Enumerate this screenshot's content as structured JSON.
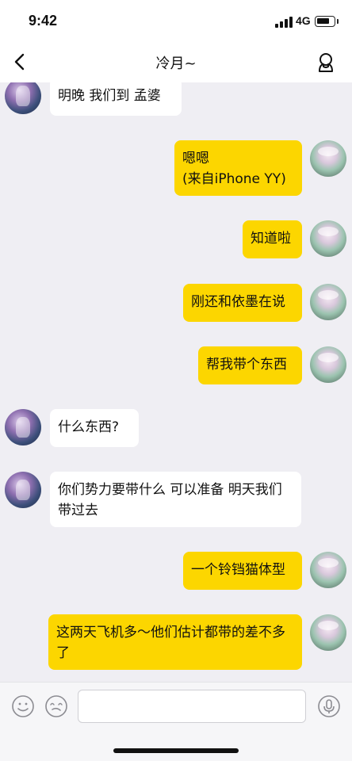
{
  "status_bar": {
    "time": "9:42",
    "network": "4G",
    "battery_level": 0.8,
    "signal_bars": 4
  },
  "nav": {
    "title": "冷月~",
    "back_icon": "chevron-left-icon",
    "profile_icon": "person-outline-icon"
  },
  "messages": [
    {
      "side": "left",
      "text": "明晚 我们到  孟婆"
    },
    {
      "side": "right",
      "text": "嗯嗯\n(来自iPhone YY)"
    },
    {
      "side": "right",
      "text": "知道啦"
    },
    {
      "side": "right",
      "text": "刚还和依墨在说"
    },
    {
      "side": "right",
      "text": "帮我带个东西"
    },
    {
      "side": "left",
      "text": "什么东西?"
    },
    {
      "side": "left",
      "text": "你们势力要带什么  可以准备 明天我们带过去"
    },
    {
      "side": "right",
      "text": "一个铃铛猫体型"
    },
    {
      "side": "right",
      "text": "这两天飞机多～他们估计都带的差不多了"
    }
  ],
  "input_bar": {
    "placeholder": "",
    "left_icons": [
      "smiley-icon",
      "sticker-icon"
    ],
    "right_icon": "microphone-icon"
  },
  "colors": {
    "chat_background": "#efeef3",
    "outgoing_bubble": "#fcd600",
    "incoming_bubble": "#ffffff"
  }
}
